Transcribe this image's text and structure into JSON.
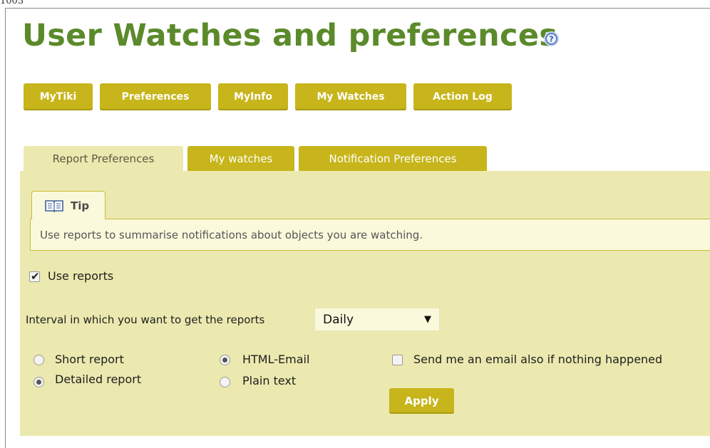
{
  "crumb": "1003",
  "page": {
    "title": "User Watches and preferences",
    "help_icon": "help-icon"
  },
  "nav": {
    "buttons": [
      "MyTiki",
      "Preferences",
      "MyInfo",
      "My Watches",
      "Action Log"
    ]
  },
  "tabs": {
    "items": [
      "Report Preferences",
      "My watches",
      "Notification Preferences"
    ],
    "active_index": 0
  },
  "tip": {
    "icon": "book-icon",
    "label": "Tip",
    "text": "Use reports to summarise notifications about objects you are watching."
  },
  "form": {
    "use_reports": {
      "label": "Use reports",
      "checked": true
    },
    "interval": {
      "label": "Interval in which you want to get the reports",
      "selected": "Daily"
    },
    "report_type": {
      "options": [
        "Short report",
        "Detailed report"
      ],
      "selected": "Detailed report"
    },
    "format": {
      "options": [
        "HTML-Email",
        "Plain text"
      ],
      "selected": "HTML-Email"
    },
    "send_always": {
      "label": "Send me an email also if nothing happened",
      "checked": false
    },
    "apply_label": "Apply"
  },
  "colors": {
    "title_green": "#5b8a2a",
    "button_olive": "#c7b51b",
    "panel_bg": "#ece9b0",
    "tip_bg": "#fbf9dc"
  }
}
